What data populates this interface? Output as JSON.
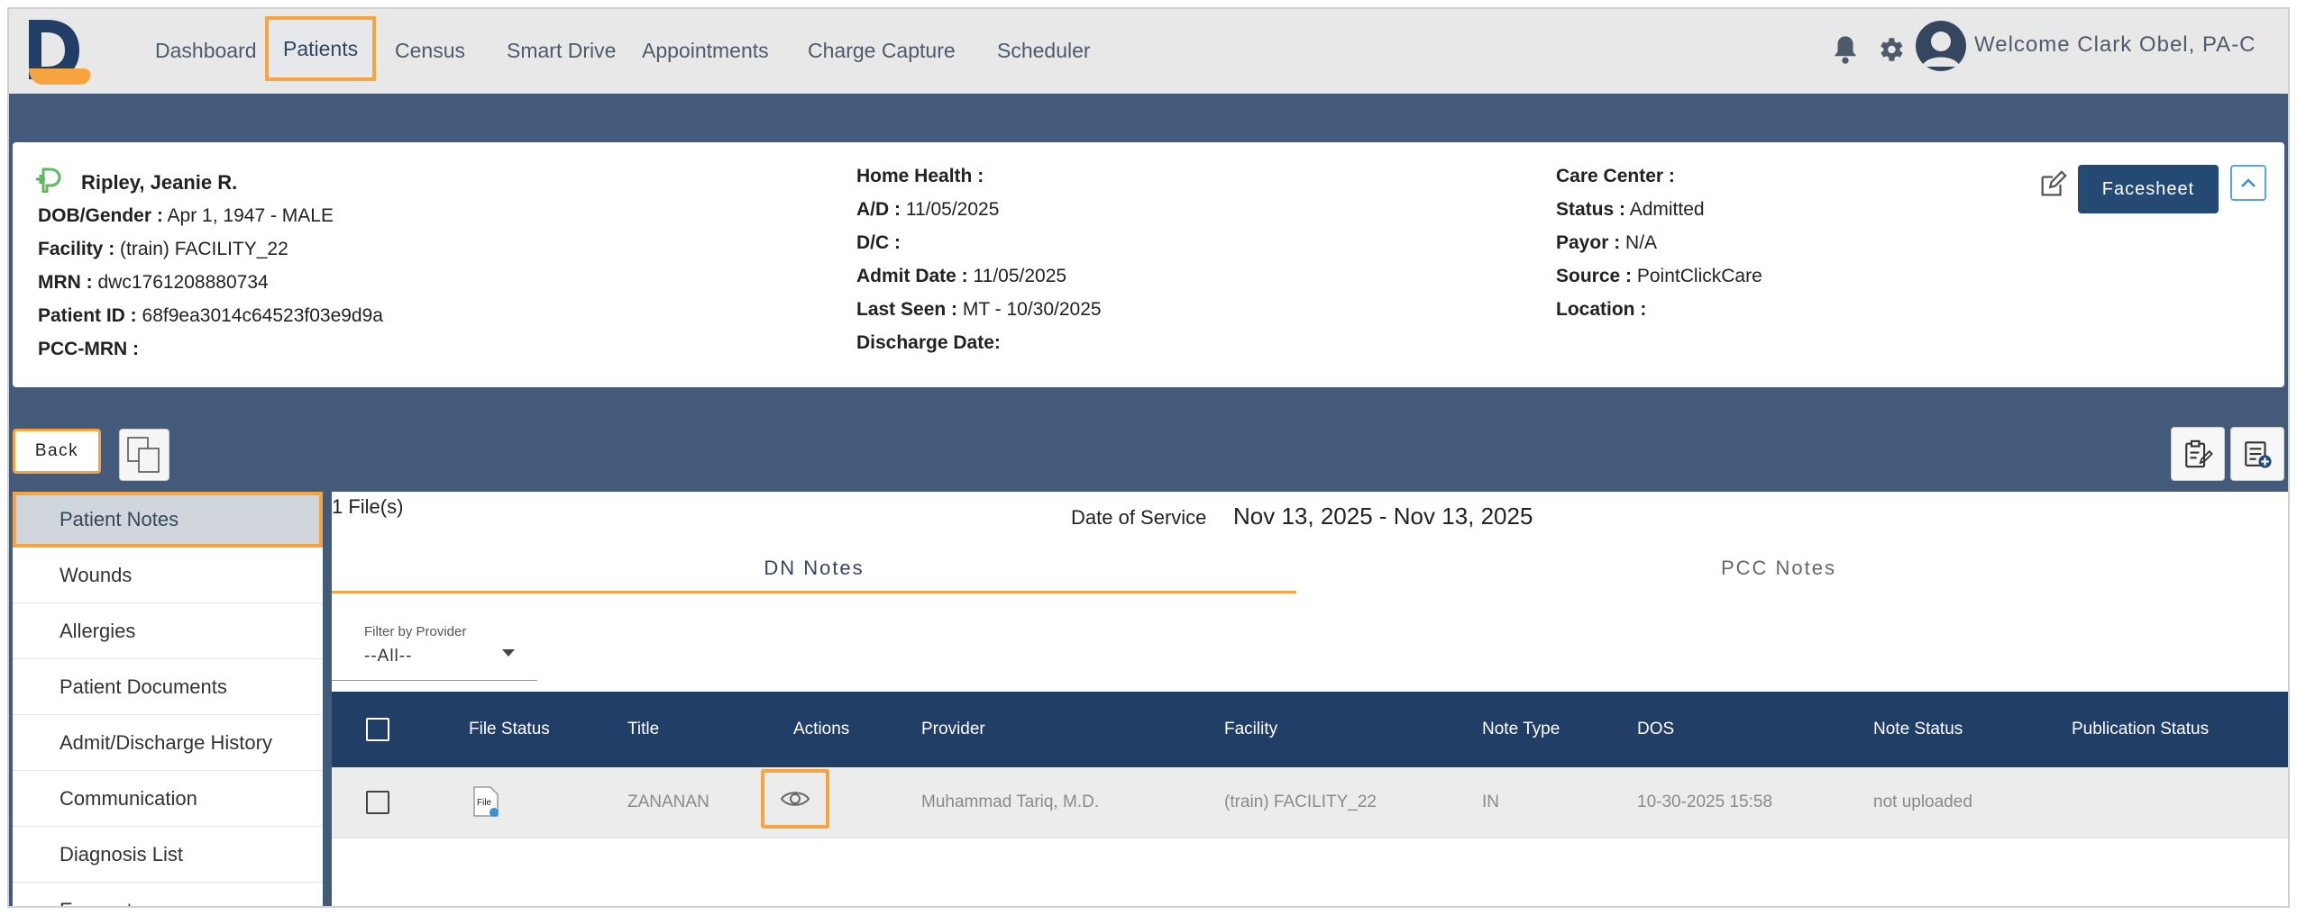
{
  "nav": {
    "items": [
      "Dashboard",
      "Patients",
      "Census",
      "Smart Drive",
      "Appointments",
      "Charge Capture",
      "Scheduler"
    ],
    "active": "Patients",
    "welcome": "Welcome Clark Obel, PA-C"
  },
  "patient": {
    "name": "Ripley, Jeanie R.",
    "dob_label": "DOB/Gender :",
    "dob_value": "Apr 1, 1947 - MALE",
    "facility_label": "Facility :",
    "facility_value": "(train) FACILITY_22",
    "mrn_label": "MRN :",
    "mrn_value": "dwc1761208880734",
    "patient_id_label": "Patient ID :",
    "patient_id_value": "68f9ea3014c64523f03e9d9a",
    "pcc_mrn_label": "PCC-MRN :",
    "pcc_mrn_value": "",
    "home_health_label": "Home Health :",
    "home_health_value": "",
    "ad_label": "A/D :",
    "ad_value": "11/05/2025",
    "dc_label": "D/C :",
    "dc_value": "",
    "admit_date_label": "Admit Date :",
    "admit_date_value": "11/05/2025",
    "last_seen_label": "Last Seen :",
    "last_seen_value": "MT - 10/30/2025",
    "discharge_date_label": "Discharge Date:",
    "discharge_date_value": "",
    "care_center_label": "Care Center :",
    "care_center_value": "",
    "status_label": "Status :",
    "status_value": "Admitted",
    "payor_label": "Payor :",
    "payor_value": "N/A",
    "source_label": "Source :",
    "source_value": "PointClickCare",
    "location_label": "Location :",
    "location_value": "",
    "facesheet_label": "Facesheet"
  },
  "toolbar": {
    "back_label": "Back"
  },
  "sidebar": {
    "items": [
      "Patient Notes",
      "Wounds",
      "Allergies",
      "Patient Documents",
      "Admit/Discharge History",
      "Communication",
      "Diagnosis List",
      "Encounter"
    ]
  },
  "main": {
    "files_count": "1 File(s)",
    "dos_label": "Date of Service",
    "dos_value": "Nov 13, 2025 - Nov 13, 2025",
    "tabs": [
      "DN Notes",
      "PCC Notes"
    ],
    "filter_label": "Filter by Provider",
    "filter_value": "--All--",
    "columns": [
      "File Status",
      "Title",
      "Actions",
      "Provider",
      "Facility",
      "Note Type",
      "DOS",
      "Note Status",
      "Publication Status"
    ],
    "rows": [
      {
        "file_icon_text": "File",
        "title": "ZANANAN",
        "provider": "Muhammad Tariq, M.D.",
        "facility": "(train) FACILITY_22",
        "note_type": "IN",
        "dos": "10-30-2025 15:58",
        "note_status": "not uploaded",
        "publication_status": ""
      }
    ]
  },
  "colors": {
    "header_bg": "#435a7b",
    "table_head": "#213f66",
    "accent": "#f6a340",
    "button": "#244a74"
  }
}
